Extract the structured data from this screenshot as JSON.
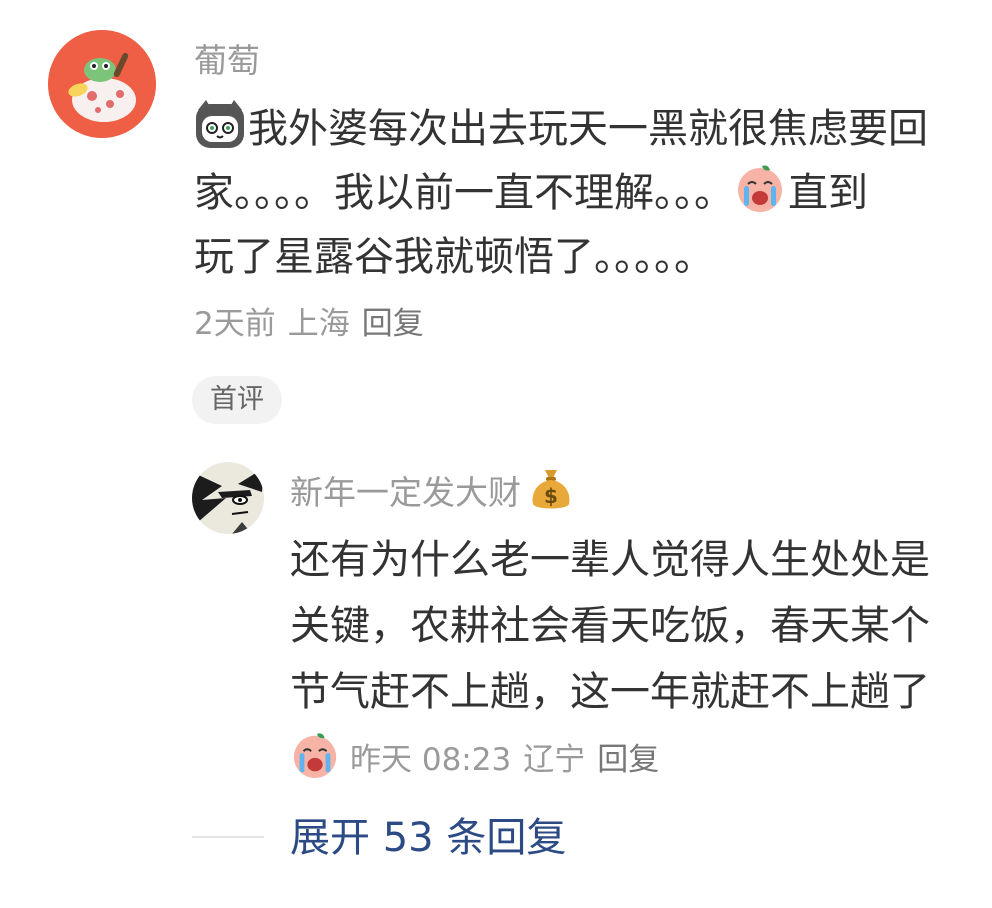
{
  "comment": {
    "author": "葡萄",
    "avatar_icon": "cartoon-avatar",
    "text_lines": [
      "我外婆每次出去玩天一黑就很焦虑要回",
      "家。。。。我以前一直不理解。。。",
      "直到",
      "玩了星露谷我就顿悟了。。。。。"
    ],
    "time": "2天前",
    "location": "上海",
    "reply_label": "回复",
    "badge": "首评"
  },
  "reply": {
    "author": "新年一定发大财",
    "avatar_icon": "anime-avatar",
    "text_lines": [
      "还有为什么老一辈人觉得人生处处是",
      "关键，农耕社会看天吃饭，春天某个",
      "节气赶不上趟，这一年就赶不上趟了"
    ],
    "time": "昨天 08:23",
    "location": "辽宁",
    "reply_label": "回复"
  },
  "expand": {
    "label": "展开 53 条回复"
  },
  "colors": {
    "meta_gray": "#9a9a9a",
    "link_blue": "#2c4a83",
    "avatar_main_bg": "#ee5f45"
  }
}
